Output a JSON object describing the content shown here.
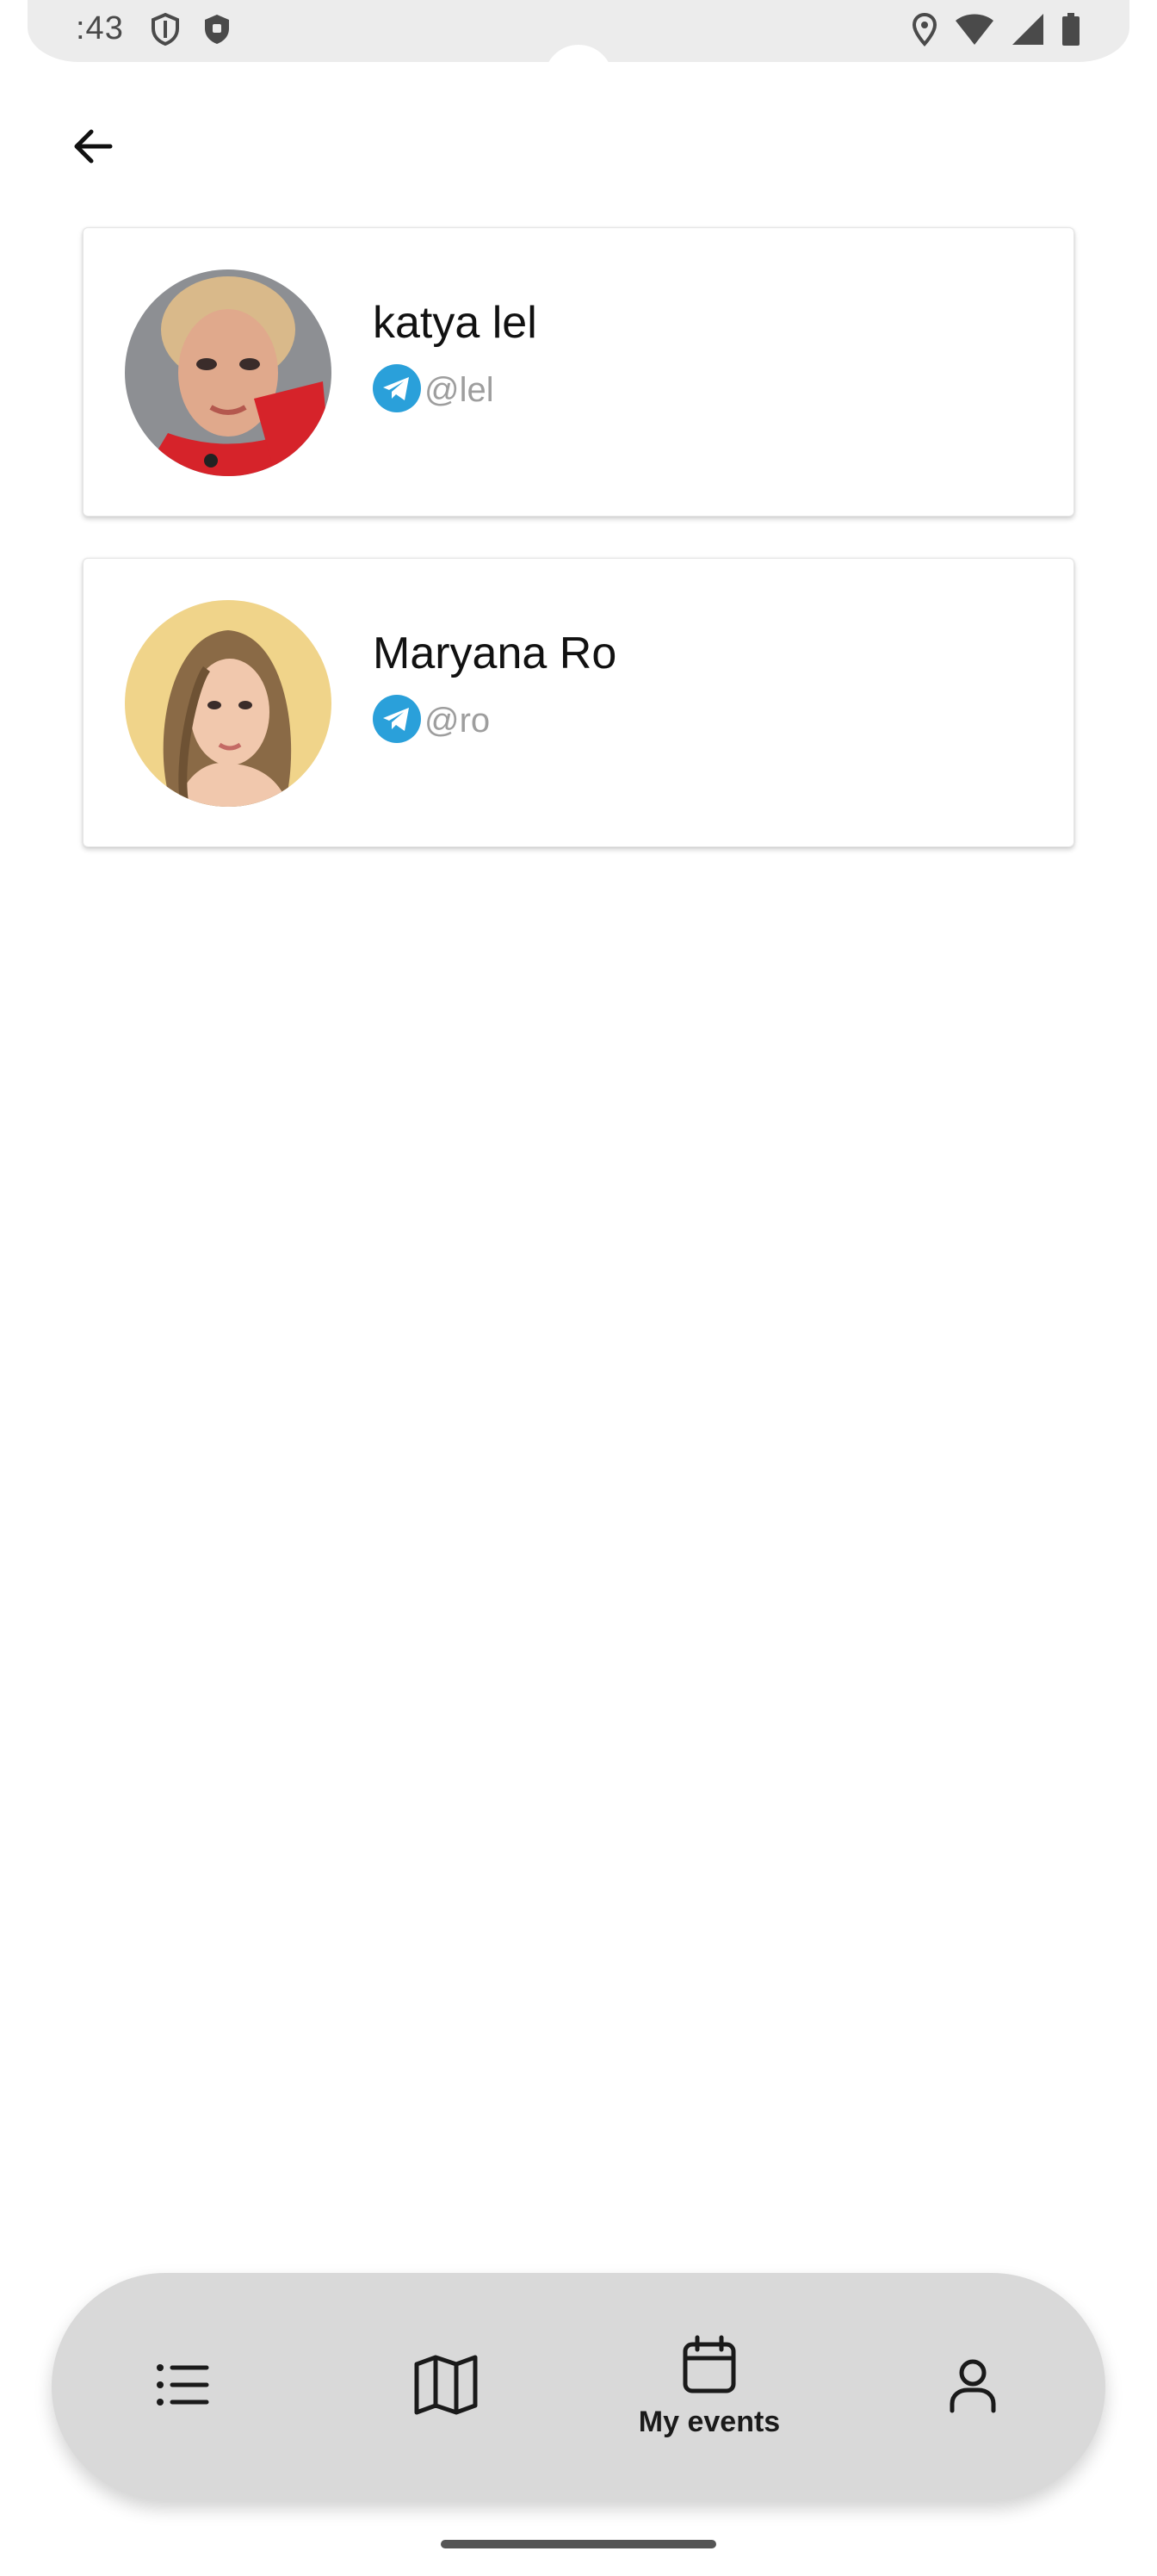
{
  "status_bar": {
    "time": ":43",
    "left_icons": [
      "shield-outline-icon",
      "shield-filled-icon"
    ],
    "right_icons": [
      "location-icon",
      "wifi-icon",
      "signal-icon",
      "battery-icon"
    ]
  },
  "header": {
    "back_icon": "arrow-left-icon"
  },
  "contacts": [
    {
      "name": "katya lel",
      "handle": "@lel",
      "messenger_icon": "telegram-icon",
      "avatar_colors": {
        "bg": "#8d8f93",
        "accent": "#d6232a"
      }
    },
    {
      "name": "Maryana Ro",
      "handle": "@ro",
      "messenger_icon": "telegram-icon",
      "avatar_colors": {
        "bg": "#f0d48a",
        "accent": "#8a6a46"
      }
    }
  ],
  "bottom_nav": {
    "items": [
      {
        "icon": "list-icon",
        "label": "",
        "selected": false
      },
      {
        "icon": "map-icon",
        "label": "",
        "selected": false
      },
      {
        "icon": "calendar-icon",
        "label": "My events",
        "selected": true
      },
      {
        "icon": "user-icon",
        "label": "",
        "selected": false
      }
    ]
  },
  "colors": {
    "telegram": "#2aa0da",
    "nav_background": "#d9d9d9",
    "handle_text": "#9e9e9e"
  }
}
